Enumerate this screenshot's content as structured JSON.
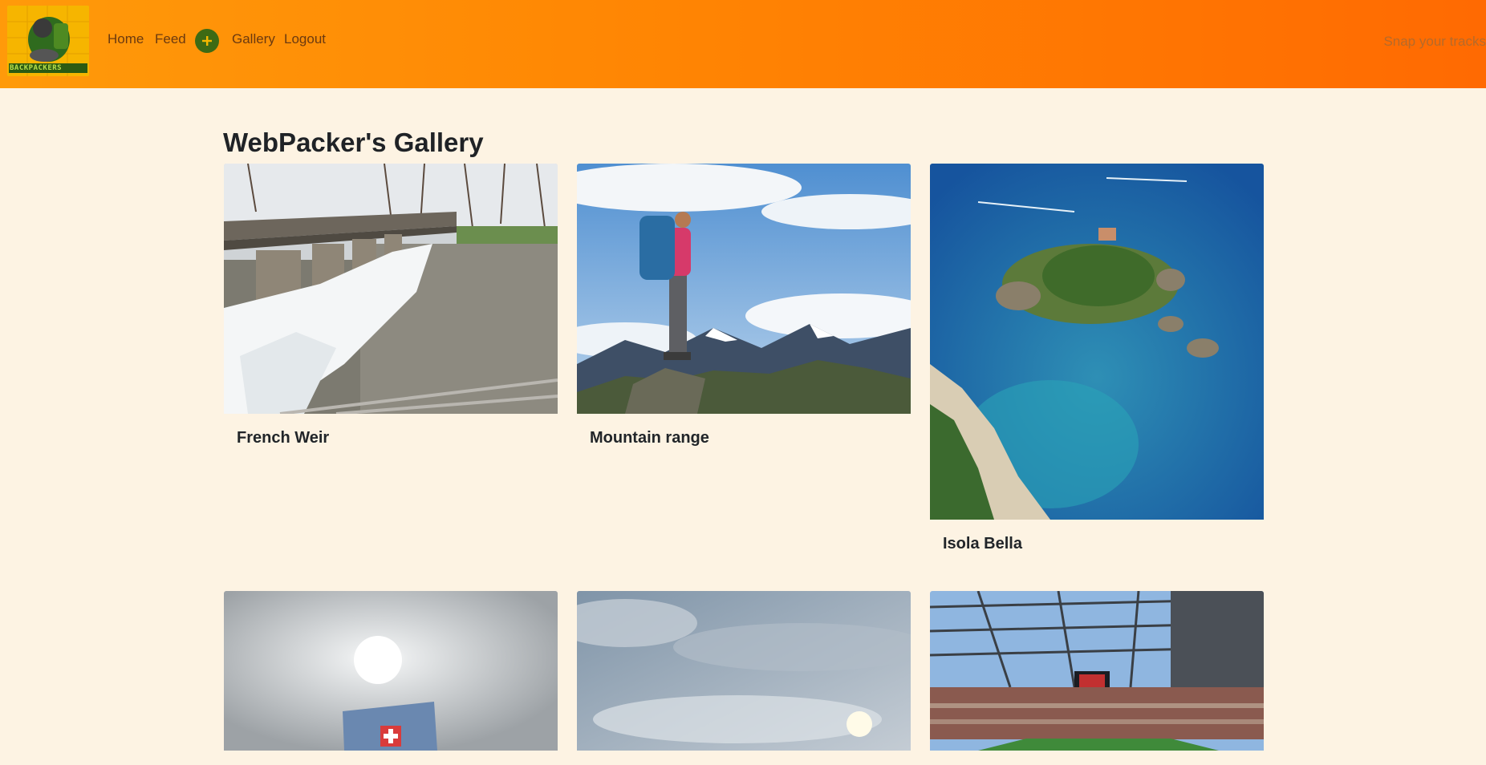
{
  "nav": {
    "logo_alt": "Backpackers logo",
    "logo_text": "BACKPACKERS",
    "home": "Home",
    "feed": "Feed",
    "add_icon": "plus-icon",
    "gallery": "Gallery",
    "logout": "Logout",
    "tagline": "Snap your tracks"
  },
  "page": {
    "title": "WebPacker's Gallery"
  },
  "gallery": [
    {
      "title": "French Weir"
    },
    {
      "title": "Mountain range"
    },
    {
      "title": "Isola Bella"
    },
    {
      "title": ""
    },
    {
      "title": ""
    },
    {
      "title": ""
    }
  ],
  "colors": {
    "nav_start": "#ff9a0a",
    "nav_end": "#ff6a02",
    "background": "#fdf3e3",
    "add_button": "#3d6a14"
  }
}
